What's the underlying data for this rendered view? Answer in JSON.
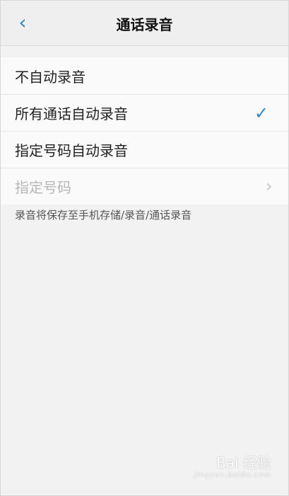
{
  "header": {
    "back_icon": "chevron-left-icon",
    "title": "通话录音"
  },
  "options": [
    {
      "label": "不自动录音",
      "selected": false
    },
    {
      "label": "所有通话自动录音",
      "selected": true,
      "selected_icon": "checkmark-icon"
    },
    {
      "label": "指定号码自动录音",
      "selected": false
    },
    {
      "label": "指定号码",
      "disabled": true,
      "chevron_icon": "chevron-right-icon"
    }
  ],
  "footer_note": "录音将保存至手机存储/录音/通话录音",
  "watermark": {
    "brand": "Bai 经验",
    "site": "jingyan.baidu.com"
  },
  "colors": {
    "accent": "#2f86d1",
    "background": "#f2f2f2",
    "surface": "#fafafa",
    "divider": "#e7e7e7"
  }
}
